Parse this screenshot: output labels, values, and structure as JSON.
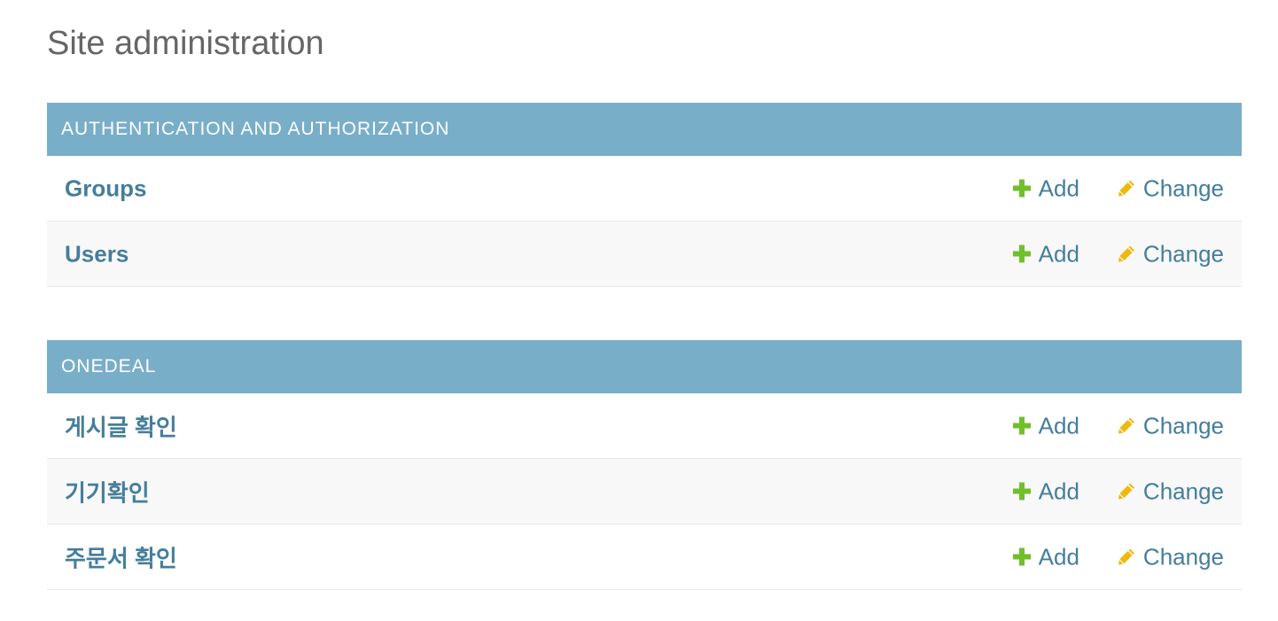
{
  "page": {
    "title": "Site administration"
  },
  "colors": {
    "header_bg": "#79aec8",
    "link": "#447e9b",
    "add_icon": "#70bf2b",
    "change_icon": "#efb80b"
  },
  "modules": [
    {
      "caption": "AUTHENTICATION AND AUTHORIZATION",
      "models": [
        {
          "name": "Groups",
          "add_label": "Add",
          "change_label": "Change"
        },
        {
          "name": "Users",
          "add_label": "Add",
          "change_label": "Change"
        }
      ]
    },
    {
      "caption": "ONEDEAL",
      "models": [
        {
          "name": "게시글 확인",
          "add_label": "Add",
          "change_label": "Change"
        },
        {
          "name": "기기확인",
          "add_label": "Add",
          "change_label": "Change"
        },
        {
          "name": "주문서 확인",
          "add_label": "Add",
          "change_label": "Change"
        }
      ]
    }
  ],
  "icons": {
    "add": "plus-icon",
    "change": "pencil-icon"
  }
}
